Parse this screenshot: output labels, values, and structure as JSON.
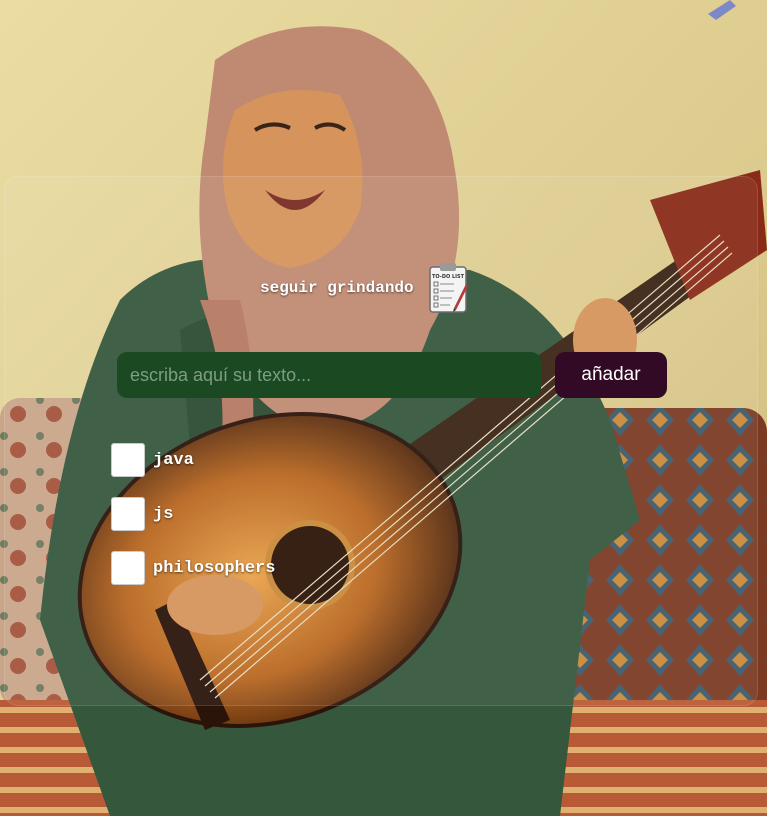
{
  "app": {
    "title": "seguir grindando",
    "title_icon": "clipboard-todo-list-icon",
    "clipboard_heading": "TO-DO LIST"
  },
  "form": {
    "input_placeholder": "escriba aquí su texto...",
    "input_value": "",
    "add_button_label": "añadar"
  },
  "todos": [
    {
      "label": "java",
      "checked": false
    },
    {
      "label": "js",
      "checked": false
    },
    {
      "label": "philosophers",
      "checked": false
    }
  ],
  "colors": {
    "input_background": "#1b4a22",
    "button_background": "#330a25",
    "text": "#ffffff"
  }
}
